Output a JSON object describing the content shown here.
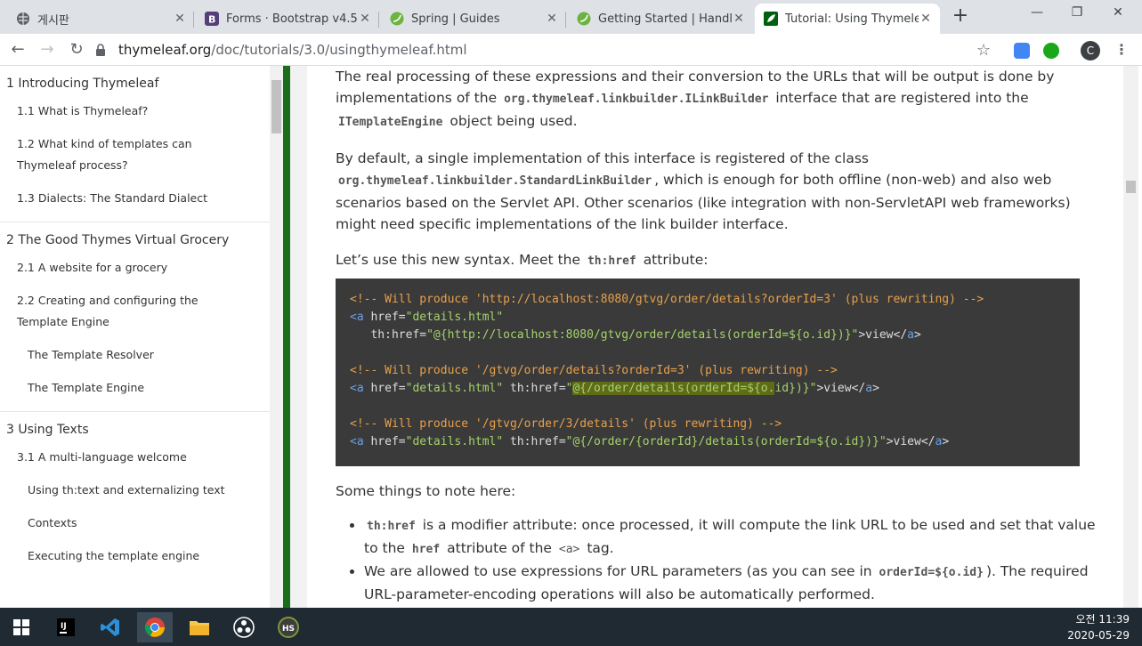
{
  "browser": {
    "tabs": [
      {
        "title": "게시판",
        "icon": "globe-icon"
      },
      {
        "title": "Forms · Bootstrap v4.5",
        "icon": "bootstrap-icon"
      },
      {
        "title": "Spring | Guides",
        "icon": "spring-icon"
      },
      {
        "title": "Getting Started | Handling",
        "icon": "spring-icon"
      },
      {
        "title": "Tutorial: Using Thymeleaf",
        "icon": "thymeleaf-icon",
        "active": true
      }
    ],
    "url_host": "thymeleaf.org",
    "url_path": "/doc/tutorials/3.0/usingthymeleaf.html",
    "profile_initial": "C"
  },
  "sidebar": {
    "sections": [
      {
        "title": "1 Introducing Thymeleaf",
        "items": [
          {
            "label": "1.1 What is Thymeleaf?",
            "level": 2
          },
          {
            "label": "1.2 What kind of templates can Thymeleaf process?",
            "level": 2
          },
          {
            "label": "1.3 Dialects: The Standard Dialect",
            "level": 2
          }
        ]
      },
      {
        "title": "2 The Good Thymes Virtual Grocery",
        "items": [
          {
            "label": "2.1 A website for a grocery",
            "level": 2
          },
          {
            "label": "2.2 Creating and configuring the Template Engine",
            "level": 2
          },
          {
            "label": "The Template Resolver",
            "level": 3
          },
          {
            "label": "The Template Engine",
            "level": 3
          }
        ]
      },
      {
        "title": "3 Using Texts",
        "items": [
          {
            "label": "3.1 A multi-language welcome",
            "level": 2
          },
          {
            "label": "Using th:text and externalizing text",
            "level": 3
          },
          {
            "label": "Contexts",
            "level": 3
          },
          {
            "label": "Executing the template engine",
            "level": 3
          }
        ]
      }
    ]
  },
  "main": {
    "p1": {
      "t1": "The real processing of these expressions and their conversion to the URLs that will be output is done by implementations of the",
      "c1": "org.thymeleaf.linkbuilder.ILinkBuilder",
      "t2": "interface that are registered into the",
      "c2": "ITemplateEngine",
      "t3": "object being used."
    },
    "p2": {
      "t1": "By default, a single implementation of this interface is registered of the class",
      "c1": "org.thymeleaf.linkbuilder.StandardLinkBuilder",
      "t2": ", which is enough for both offline (non-web) and also web scenarios based on the Servlet API. Other scenarios (like integration with non-ServletAPI web frameworks) might need specific implementations of the link builder interface."
    },
    "p3": {
      "t1": "Let’s use this new syntax. Meet the",
      "c1": "th:href",
      "t2": "attribute:"
    },
    "code": {
      "l1_comment": "<!-- Will produce 'http://localhost:8080/gtvg/order/details?orderId=3' (plus rewriting) -->",
      "l2_tag": "<a",
      "l2_attr": " href=",
      "l2_val": "\"details.html\"",
      "l3_attr": "   th:href=",
      "l3_val": "\"@{http://localhost:8080/gtvg/order/details(orderId=${o.id})}\"",
      "l3_text": ">view</",
      "l3_close": "a",
      "l3_end": ">",
      "l5_comment": "<!-- Will produce '/gtvg/order/details?orderId=3' (plus rewriting) -->",
      "l6_tag": "<a",
      "l6_attr": " href=",
      "l6_val": "\"details.html\"",
      "l6_attr2": " th:href=",
      "l6_q": "\"",
      "l6_val2": "@{/order/details(orderId=${o.",
      "l6_val3": "id})}\"",
      "l6_text": ">view</",
      "l6_close": "a",
      "l6_end": ">",
      "l8_comment": "<!-- Will produce '/gtvg/order/3/details' (plus rewriting) -->",
      "l9_tag": "<a",
      "l9_attr": " href=",
      "l9_val": "\"details.html\"",
      "l9_attr2": " th:href=",
      "l9_val2": "\"@{/order/{orderId}/details(orderId=${o.id})}\"",
      "l9_text": ">view</",
      "l9_close": "a",
      "l9_end": ">"
    },
    "p4": "Some things to note here:",
    "notes": [
      {
        "c1": "th:href",
        "t1": "is a modifier attribute: once processed, it will compute the link URL to be used and set that value to the",
        "c2": "href",
        "t2": "attribute of the",
        "c3": "<a>",
        "t3": "tag."
      },
      {
        "t1": "We are allowed to use expressions for URL parameters (as you can see in",
        "c1": "orderId=${o.id}",
        "t2": "). The required URL-parameter-encoding operations will also be automatically performed."
      }
    ]
  },
  "taskbar": {
    "time": "오전 11:39",
    "date": "2020-05-29"
  }
}
